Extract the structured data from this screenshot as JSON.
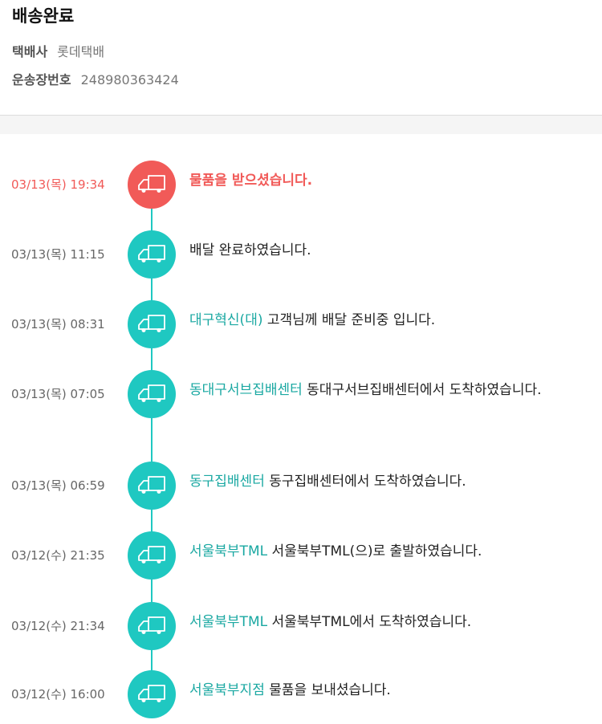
{
  "status": {
    "title": "배송완료"
  },
  "carrier": {
    "label": "택배사",
    "value": "롯데택배"
  },
  "tracking": {
    "label": "운송장번호",
    "value": "248980363424"
  },
  "colors": {
    "accent": "#1fc8c1",
    "active": "#f15a58",
    "location_text": "#1aa8a2"
  },
  "events": [
    {
      "time": "03/13(목) 19:34",
      "location": "",
      "message": "물품을 받으셨습니다.",
      "active": true,
      "icon": "truck-icon"
    },
    {
      "time": "03/13(목) 11:15",
      "location": "",
      "message": "배달 완료하였습니다.",
      "active": false,
      "icon": "truck-icon"
    },
    {
      "time": "03/13(목) 08:31",
      "location": "대구혁신(대)",
      "message": "고객님께 배달 준비중 입니다.",
      "active": false,
      "icon": "truck-icon"
    },
    {
      "time": "03/13(목) 07:05",
      "location": "동대구서브집배센터",
      "message": "동대구서브집배센터에서 도착하였습니다.",
      "active": false,
      "icon": "truck-icon"
    },
    {
      "time": "03/13(목) 06:59",
      "location": "동구집배센터",
      "message": "동구집배센터에서 도착하였습니다.",
      "active": false,
      "icon": "truck-icon"
    },
    {
      "time": "03/12(수) 21:35",
      "location": "서울북부TML",
      "message": "서울북부TML(으)로 출발하였습니다.",
      "active": false,
      "icon": "truck-icon"
    },
    {
      "time": "03/12(수) 21:34",
      "location": "서울북부TML",
      "message": "서울북부TML에서 도착하였습니다.",
      "active": false,
      "icon": "truck-icon"
    },
    {
      "time": "03/12(수) 16:00",
      "location": "서울북부지점",
      "message": "물품을 보내셨습니다.",
      "active": false,
      "icon": "truck-icon"
    }
  ]
}
